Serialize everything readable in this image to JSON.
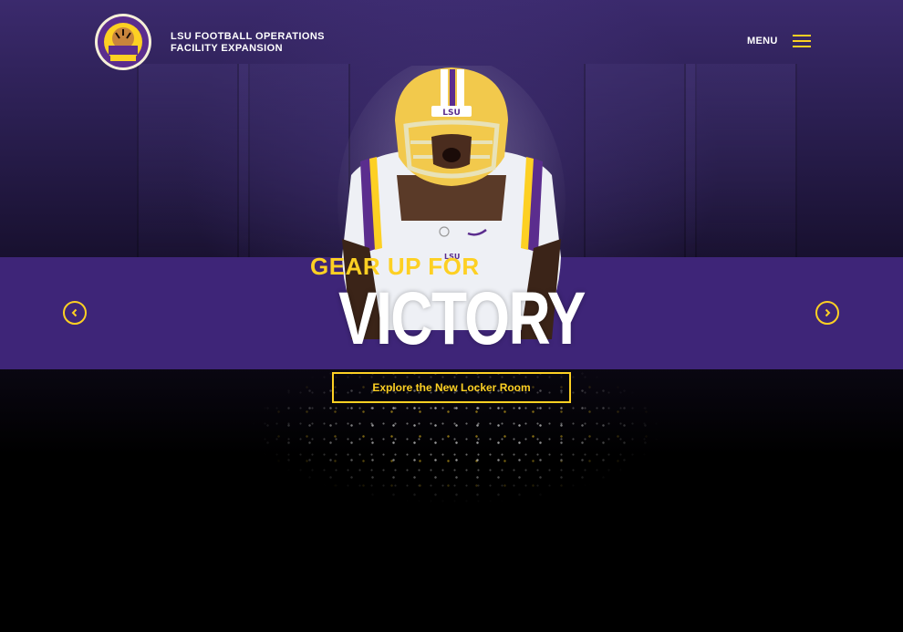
{
  "brand": {
    "logo_icon": "tiger-athletic-foundation-logo",
    "title_line1": "LSU FOOTBALL OPERATIONS",
    "title_line2": "FACILITY EXPANSION"
  },
  "nav": {
    "menu_label": "MENU",
    "menu_icon": "hamburger-icon"
  },
  "hero": {
    "eyebrow": "GEAR UP FOR",
    "headline": "VICTORY",
    "cta_label": "Explore the New Locker Room",
    "prev_icon": "chevron-left-icon",
    "next_icon": "chevron-right-icon"
  },
  "colors": {
    "accent_gold": "#fdd023",
    "purple_band": "#3e2578",
    "background": "#000000"
  }
}
